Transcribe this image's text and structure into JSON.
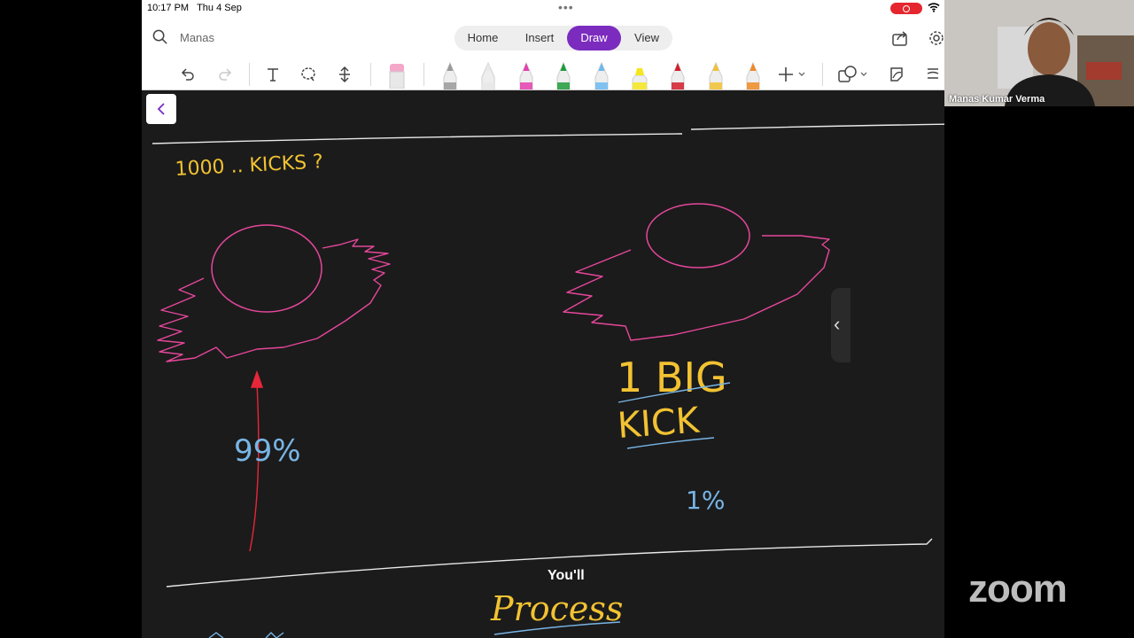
{
  "status": {
    "time": "10:17 PM",
    "date": "Thu 4 Sep"
  },
  "search": {
    "text": "Manas"
  },
  "tabs": [
    "Home",
    "Insert",
    "Draw",
    "View"
  ],
  "active_tab": "Draw",
  "icons": {
    "search": "search-icon",
    "undo": "undo-icon",
    "redo": "redo-icon",
    "text": "text-tool-icon",
    "lasso": "lasso-icon",
    "space": "insert-space-icon",
    "eraser": "eraser-icon",
    "add": "add-pen-icon",
    "shapes": "shapes-icon",
    "ink2text": "ink-to-text-icon",
    "ink2shape": "ink-to-shape-icon",
    "share": "share-icon",
    "settings": "gear-icon",
    "back": "chevron-left-icon",
    "recording": "screen-recording-icon",
    "wifi": "wifi-icon"
  },
  "pens": [
    {
      "name": "pencil",
      "color": "#9a9a9a"
    },
    {
      "name": "pen-white",
      "color": "#e8e8e8"
    },
    {
      "name": "pen-pink",
      "color": "#e43fae"
    },
    {
      "name": "pen-green",
      "color": "#1e9b3a"
    },
    {
      "name": "pen-blue",
      "color": "#6cb8f0"
    },
    {
      "name": "highlighter-yellow",
      "color": "#f5e61d"
    },
    {
      "name": "pen-red",
      "color": "#d21c2a"
    },
    {
      "name": "pen-yellow",
      "color": "#f1c232"
    },
    {
      "name": "pen-orange",
      "color": "#f08a24"
    }
  ],
  "ink_colors": {
    "yellow": "#f2c232",
    "pink": "#e6479b",
    "blue": "#78b5e6",
    "red": "#e8263a",
    "white": "#e9e9e9"
  },
  "ink_text": {
    "kicks": "1000 .. KICKS ?",
    "pct99": "99%",
    "big": "1 BIG",
    "kick": "KICK",
    "pct1": "1%",
    "process": "Process"
  },
  "caption": "You'll",
  "participant": {
    "name": "Manas Kumar Verma"
  },
  "zoom_logo": "zoom"
}
